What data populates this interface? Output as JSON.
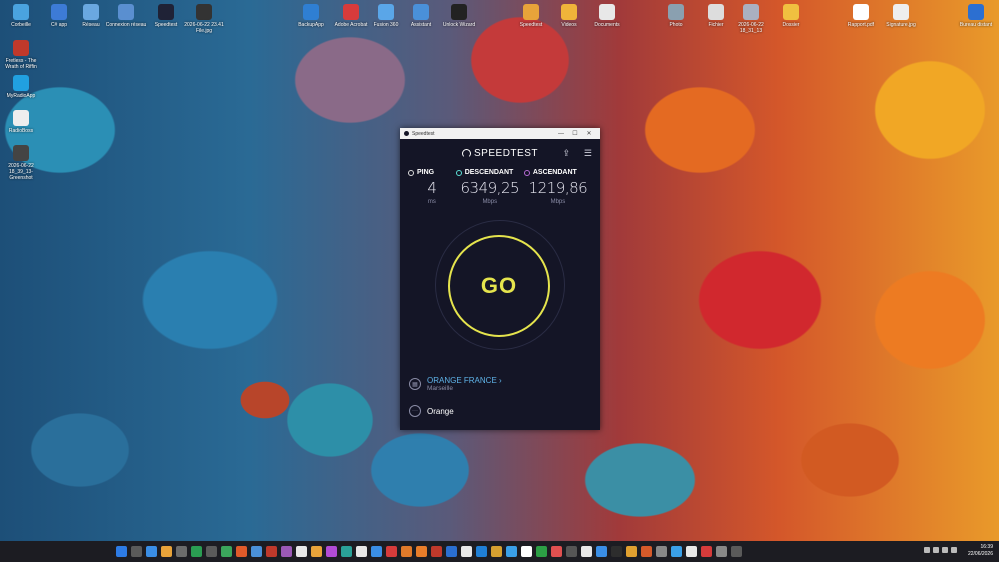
{
  "desktop": {
    "icons": [
      {
        "label": "Corbeille",
        "color": "#4aa3df"
      },
      {
        "label": "C# app",
        "color": "#3d7bd6"
      },
      {
        "label": "Réseau",
        "color": "#6aa8e0"
      },
      {
        "label": "Connexion réseau",
        "color": "#5a8fd0"
      },
      {
        "label": "Speedtest",
        "color": "#1f2236"
      },
      {
        "label": "2026-06-22 23.41 File.jpg",
        "color": "#333333"
      },
      {
        "label": "Fretless - The Wrath of Riffin",
        "color": "#c0392b"
      },
      {
        "label": "MyRadioApp",
        "color": "#21a0e0"
      },
      {
        "label": "RadioBoss",
        "color": "#eeeeee"
      },
      {
        "label": "2026-06-22 18_39_13-Greenshot",
        "color": "#444444"
      },
      {
        "label": "BackupApp",
        "color": "#2f7fd3"
      },
      {
        "label": "Adobe Acrobat",
        "color": "#d83b3b"
      },
      {
        "label": "Fusion 360",
        "color": "#5aa6e8"
      },
      {
        "label": "Assistant",
        "color": "#4a90d9"
      },
      {
        "label": "Unlock Wizard",
        "color": "#222222"
      },
      {
        "label": "Speedtest",
        "color": "#e8a33a"
      },
      {
        "label": "Videos",
        "color": "#f0b43a"
      },
      {
        "label": "Documents",
        "color": "#e8e8e8"
      },
      {
        "label": "Photo",
        "color": "#8aa0b0"
      },
      {
        "label": "Fichier",
        "color": "#dddddd"
      },
      {
        "label": "2026-06-22 18_31_13",
        "color": "#aab0c0"
      },
      {
        "label": "Dossier",
        "color": "#f0c040"
      },
      {
        "label": "Rapport.pdf",
        "color": "#ffffff"
      },
      {
        "label": "Signature.jpg",
        "color": "#eeeeee"
      },
      {
        "label": "Bureau distant",
        "color": "#2c6fd1"
      }
    ]
  },
  "window": {
    "title": "Speedtest",
    "minimize": "—",
    "maximize": "☐",
    "close": "✕"
  },
  "app": {
    "logo": "SPEEDTEST",
    "share_icon": "⇪",
    "settings_icon": "☰",
    "ping": {
      "label": "PING",
      "value": "4",
      "unit": "ms"
    },
    "download": {
      "label": "DESCENDANT",
      "value": "6349,25",
      "unit": "Mbps"
    },
    "upload": {
      "label": "ASCENDANT",
      "value": "1219,86",
      "unit": "Mbps"
    },
    "go": "GO",
    "isp": {
      "name": "ORANGE FRANCE ›",
      "location": "Marseille"
    },
    "server": "Orange"
  },
  "taskbar": {
    "icon_colors": [
      "#2d7be5",
      "#5a5a5a",
      "#3a8ee6",
      "#e8a33a",
      "#6b6b6b",
      "#2a9d52",
      "#5a5a5a",
      "#3ba55c",
      "#e05a2a",
      "#4a90d9",
      "#c0392b",
      "#9b59b6",
      "#e8e8e8",
      "#e8a33a",
      "#b14bd6",
      "#2aa198",
      "#e8e8e8",
      "#3a8ee6",
      "#d63b3b",
      "#e07a2a",
      "#e87d2a",
      "#c0392b",
      "#2a6fd1",
      "#e8e8e8",
      "#1f7fd6",
      "#d6a030",
      "#3aa0e8",
      "#ffffff",
      "#2c9f45",
      "#e05050",
      "#555555",
      "#e8e8e8",
      "#3a8ee6",
      "#2d2d2d",
      "#e0a030",
      "#d65a2a",
      "#888888",
      "#3aa0e8",
      "#e8e8e8",
      "#d63b3b",
      "#888888",
      "#5a5a5a"
    ],
    "time": "16:39",
    "date": "22/06/2026"
  }
}
